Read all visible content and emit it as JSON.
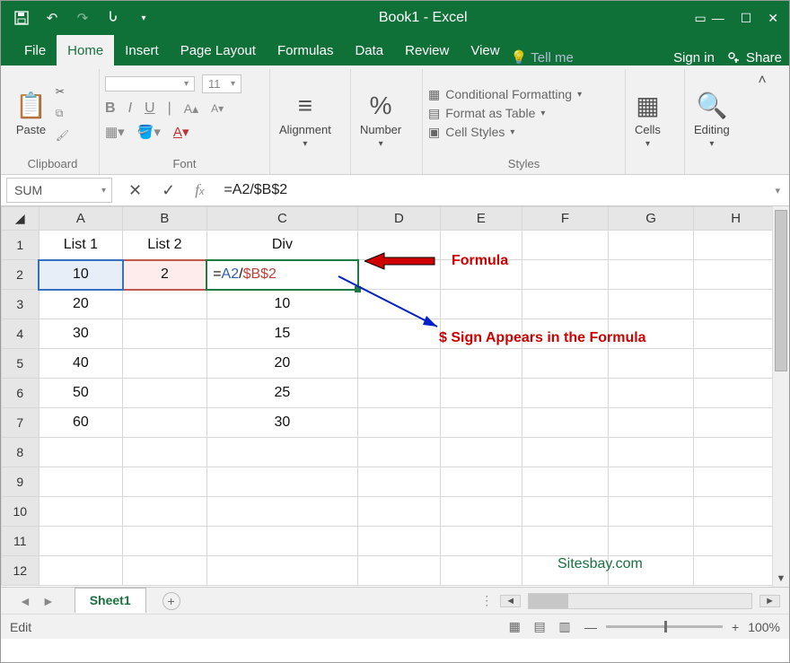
{
  "title": "Book1 - Excel",
  "qat": [
    "save-icon",
    "undo-icon",
    "redo-icon",
    "touch-icon",
    "qat-more-icon"
  ],
  "tabs": [
    "File",
    "Home",
    "Insert",
    "Page Layout",
    "Formulas",
    "Data",
    "Review",
    "View"
  ],
  "tell_me": "Tell me",
  "signin": "Sign in",
  "share": "Share",
  "ribbon": {
    "clipboard": {
      "label": "Clipboard",
      "paste": "Paste"
    },
    "font": {
      "label": "Font",
      "name": "",
      "size": "11"
    },
    "alignment": "Alignment",
    "number": "Number",
    "styles": {
      "label": "Styles",
      "cond": "Conditional Formatting",
      "table": "Format as Table",
      "cell": "Cell Styles"
    },
    "cells": "Cells",
    "editing": "Editing"
  },
  "namebox": "SUM",
  "formula_bar": "=A2/$B$2",
  "columns": [
    "A",
    "B",
    "C",
    "D",
    "E",
    "F",
    "G",
    "H"
  ],
  "rows": [
    "1",
    "2",
    "3",
    "4",
    "5",
    "6",
    "7",
    "8",
    "9",
    "10",
    "11",
    "12"
  ],
  "data": {
    "A1": "List 1",
    "B1": "List 2",
    "C1": "Div",
    "A2": "10",
    "B2": "2",
    "C2": "=A2/$B$2",
    "A3": "20",
    "C3": "10",
    "A4": "30",
    "C4": "15",
    "A5": "40",
    "C5": "20",
    "A6": "50",
    "C6": "25",
    "A7": "60",
    "C7": "30"
  },
  "annotation_formula": "Formula",
  "annotation_dollar": "$ Sign Appears in the Formula",
  "watermark": "Sitesbay.com",
  "sheet_tab": "Sheet1",
  "status": "Edit",
  "zoom": "100%"
}
